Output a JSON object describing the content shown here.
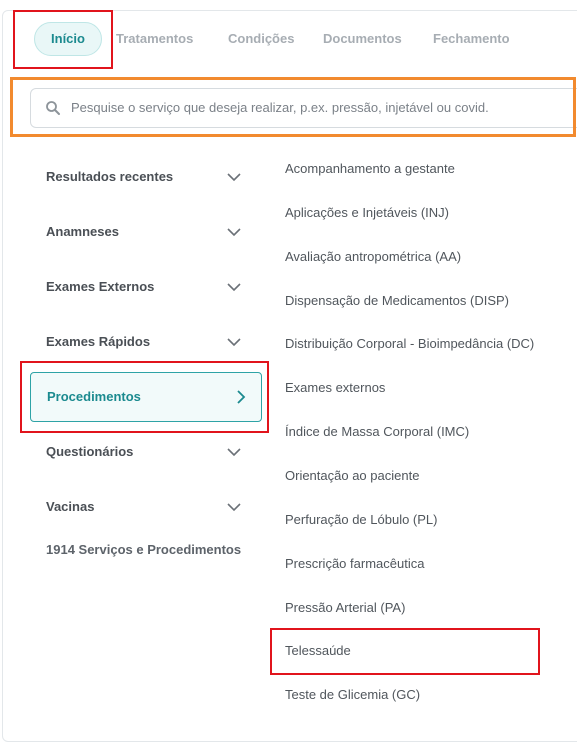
{
  "tabs": [
    {
      "label": "Início",
      "active": true
    },
    {
      "label": "Tratamentos"
    },
    {
      "label": "Condições"
    },
    {
      "label": "Documentos"
    },
    {
      "label": "Fechamento"
    }
  ],
  "search": {
    "placeholder": "Pesquise o serviço que deseja realizar, p.ex. pressão, injetável ou covid.",
    "icon": "search-icon"
  },
  "categories": [
    {
      "label": "Resultados recentes",
      "icon": "chevron-down-icon"
    },
    {
      "label": "Anamneses",
      "icon": "chevron-down-icon"
    },
    {
      "label": "Exames Externos",
      "icon": "chevron-down-icon"
    },
    {
      "label": "Exames Rápidos",
      "icon": "chevron-down-icon"
    },
    {
      "label": "Procedimentos",
      "icon": "chevron-right-icon",
      "active": true
    },
    {
      "label": "Questionários",
      "icon": "chevron-down-icon"
    },
    {
      "label": "Vacinas",
      "icon": "chevron-down-icon"
    }
  ],
  "services_count": "1914 Serviços e Procedimentos",
  "procedures": [
    "Acompanhamento a gestante",
    "Aplicações e Injetáveis (INJ)",
    "Avaliação antropométrica (AA)",
    "Dispensação de Medicamentos (DISP)",
    "Distribuição Corporal - Bioimpedância (DC)",
    "Exames externos",
    "Índice de Massa Corporal (IMC)",
    "Orientação ao paciente",
    "Perfuração de Lóbulo (PL)",
    "Prescrição farmacêutica",
    "Pressão Arterial (PA)",
    "Telessaúde",
    "Teste de Glicemia (GC)"
  ],
  "colors": {
    "accent": "#1b8a8f",
    "highlight_red": "#e1141c",
    "highlight_orange": "#f28a2e"
  }
}
